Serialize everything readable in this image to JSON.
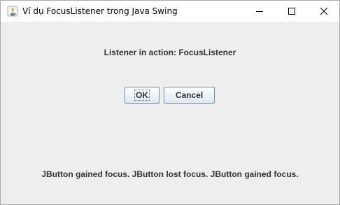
{
  "window": {
    "title": "Ví dụ FocusListener trong Java Swing",
    "app_icon": "java-icon",
    "controls": [
      "minimize-icon",
      "maximize-icon",
      "close-icon"
    ]
  },
  "content": {
    "heading": "Listener in action: FocusListener",
    "buttons": {
      "ok_label": "OK",
      "cancel_label": "Cancel"
    },
    "focused_button": "OK",
    "status": "JButton gained focus. JButton lost focus. JButton gained focus."
  },
  "colors": {
    "background": "#eeeeee",
    "text": "#333333",
    "button_border": "#7a8a99"
  }
}
